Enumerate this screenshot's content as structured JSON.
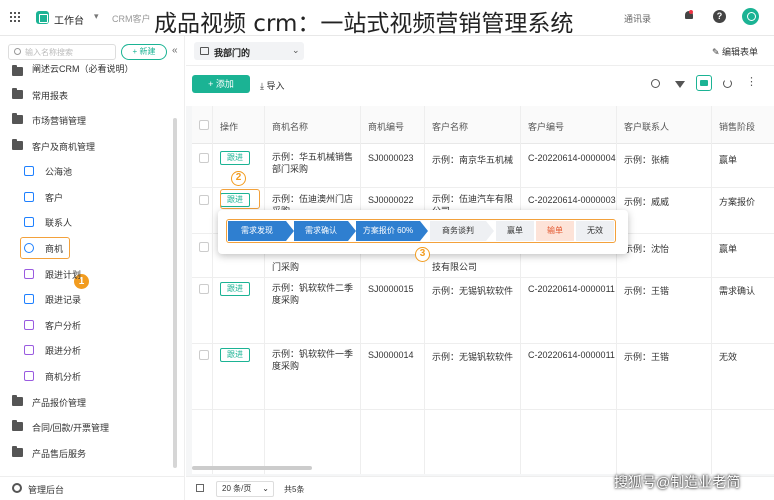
{
  "overlay_title": "成品视频 crm：一站式视频营销管理系统",
  "topbar": {
    "workspace": "工作台",
    "tab": "CRM客户",
    "contacts": "通讯录",
    "help": "?"
  },
  "sidebar": {
    "search_placeholder": "输入名称搜索",
    "new_label": "+ 新建",
    "items": [
      {
        "label": "阐述云CRM（必看说明）"
      },
      {
        "label": "常用报表"
      },
      {
        "label": "市场营销管理"
      },
      {
        "label": "客户及商机管理"
      },
      {
        "label": "公海池"
      },
      {
        "label": "客户"
      },
      {
        "label": "联系人"
      },
      {
        "label": "商机"
      },
      {
        "label": "跟进计划"
      },
      {
        "label": "跟进记录"
      },
      {
        "label": "客户分析"
      },
      {
        "label": "跟进分析"
      },
      {
        "label": "商机分析"
      },
      {
        "label": "产品报价管理"
      },
      {
        "label": "合同/回款/开票管理"
      },
      {
        "label": "产品售后服务"
      }
    ],
    "footer": "管理后台"
  },
  "view": {
    "name": "我部门的",
    "edit_form": "编辑表单"
  },
  "toolbar": {
    "add": "+ 添加",
    "import": "导入"
  },
  "table": {
    "headers": [
      "操作",
      "商机名称",
      "商机编号",
      "客户名称",
      "客户编号",
      "客户联系人",
      "销售阶段"
    ],
    "follow_label": "跟进",
    "rows": [
      {
        "name": "示例：华五机械销售部门采购",
        "code": "SJ0000023",
        "customer": "示例：南京华五机械",
        "cust_code": "C-20220614-0000004",
        "contact": "示例：张楠",
        "stage": "赢单"
      },
      {
        "name": "示例：伍迪澳州门店采购",
        "code": "SJ0000022",
        "customer": "示例：伍迪汽车有限公司",
        "cust_code": "C-20220614-0000003",
        "contact": "示例：威威",
        "stage": "方案报价"
      },
      {
        "name": "门采购",
        "code": "",
        "customer": "技有限公司",
        "cust_code": "",
        "contact": "示例：沈怡",
        "stage": "赢单"
      },
      {
        "name": "示例：钒软软件二季度采购",
        "code": "SJ0000015",
        "customer": "示例：无锡钒软软件",
        "cust_code": "C-20220614-0000011",
        "contact": "示例：王锴",
        "stage": "需求确认"
      },
      {
        "name": "示例：钒软软件一季度采购",
        "code": "SJ0000014",
        "customer": "示例：无锡钒软软件",
        "cust_code": "C-20220614-0000011",
        "contact": "示例：王锴",
        "stage": "无效"
      }
    ]
  },
  "stages": [
    {
      "label": "需求发现"
    },
    {
      "label": "需求确认"
    },
    {
      "label": "方案报价 60%"
    },
    {
      "label": "商务谈判"
    },
    {
      "label": "赢单"
    },
    {
      "label": "输单"
    },
    {
      "label": "无效"
    }
  ],
  "badges": [
    "1",
    "2",
    "3"
  ],
  "pager": {
    "page_size": "20 条/页",
    "total": "共5条"
  },
  "watermark": "搜狐号@制造业老简",
  "colors": {
    "accent": "#1bb394",
    "highlight": "#f3a13b",
    "stage_done": "#2f7fd0",
    "stage_lose": "#e2542b"
  }
}
